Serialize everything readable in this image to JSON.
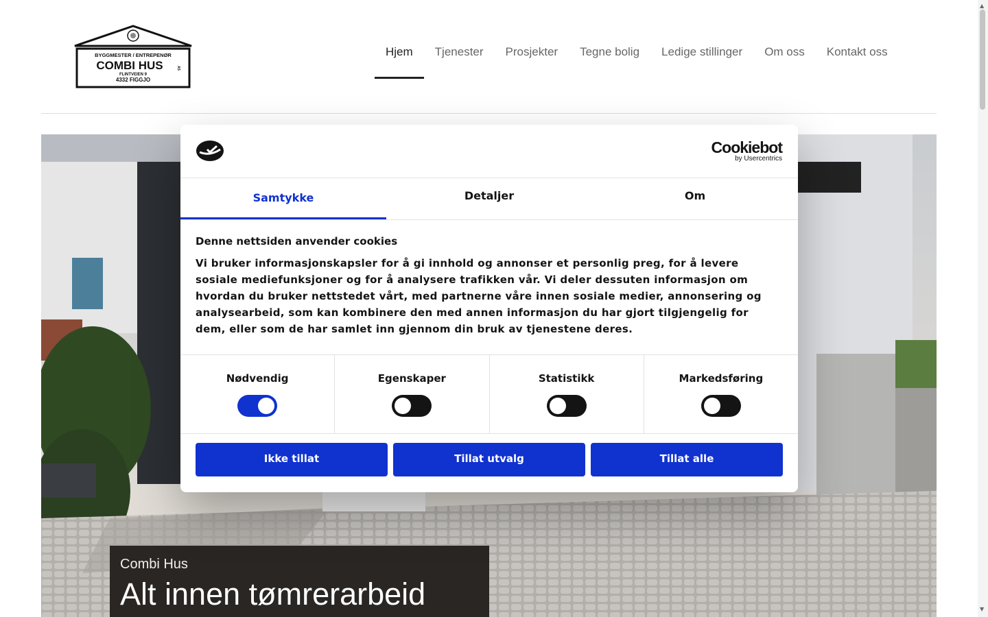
{
  "logo": {
    "line1": "BYGGMESTER / ENTREPENØR",
    "name": "COMBI HUS",
    "suffix": "AS",
    "address": "FLINTVEIEN 9",
    "city": "4332 FIGGJO"
  },
  "nav": {
    "items": [
      {
        "label": "Hjem",
        "active": true
      },
      {
        "label": "Tjenester"
      },
      {
        "label": "Prosjekter"
      },
      {
        "label": "Tegne bolig"
      },
      {
        "label": "Ledige stillinger"
      },
      {
        "label": "Om oss"
      },
      {
        "label": "Kontakt oss"
      }
    ]
  },
  "hero": {
    "subtitle": "Combi Hus",
    "title": "Alt innen tømrerarbeid"
  },
  "cookie": {
    "brand": "Cookiebot",
    "brand_sub": "by Usercentrics",
    "tabs": [
      {
        "label": "Samtykke",
        "active": true
      },
      {
        "label": "Detaljer"
      },
      {
        "label": "Om"
      }
    ],
    "heading": "Denne nettsiden anvender cookies",
    "text_lines": [
      "Vi bruker informasjonskapsler for å gi innhold og annonser et personlig preg, for å levere",
      "sosiale mediefunksjoner og for å analysere trafikken vår. Vi deler dessuten informasjon om",
      "hvordan du bruker nettstedet vårt, med partnerne våre innen sosiale medier, annonsering og",
      "analysearbeid, som kan kombinere den med annen informasjon du har gjort tilgjengelig for",
      "dem, eller som de har samlet inn gjennom din bruk av tjenestene deres."
    ],
    "toggles": [
      {
        "label": "Nødvendig",
        "on": true
      },
      {
        "label": "Egenskaper",
        "on": false
      },
      {
        "label": "Statistikk",
        "on": false
      },
      {
        "label": "Markedsføring",
        "on": false
      }
    ],
    "buttons": {
      "deny": "Ikke tillat",
      "selection": "Tillat utvalg",
      "all": "Tillat alle"
    }
  },
  "colors": {
    "accent": "#1032cf",
    "caption_bg": "#2a2624",
    "nav_active": "#222222",
    "nav_inactive": "#666666"
  }
}
